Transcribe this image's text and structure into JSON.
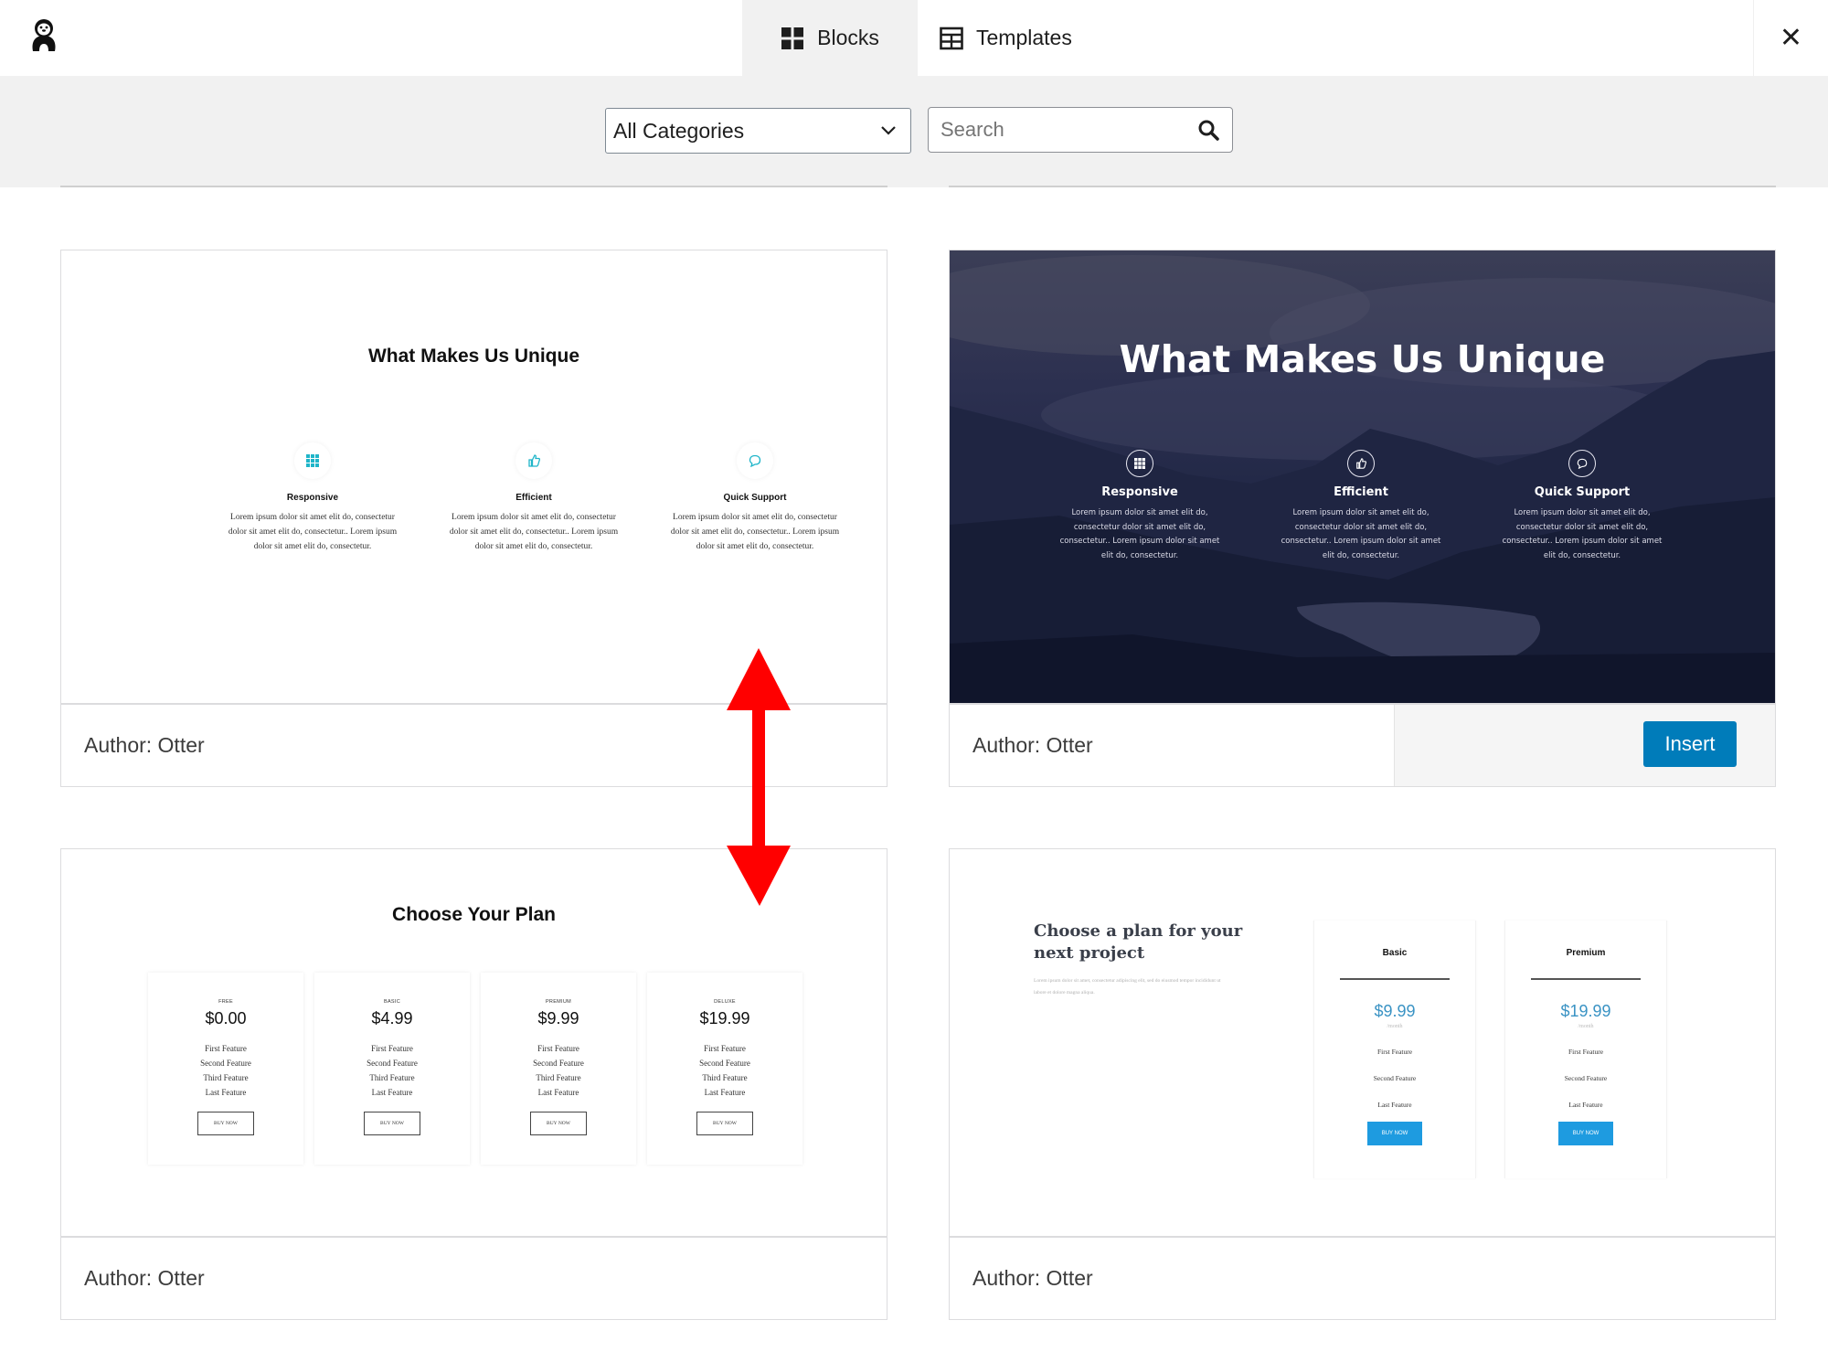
{
  "header": {
    "logo_icon": "otter-logo-icon",
    "tabs": [
      {
        "label": "Blocks",
        "icon": "blocks-grid-icon",
        "active": true
      },
      {
        "label": "Templates",
        "icon": "templates-table-icon",
        "active": false
      }
    ],
    "close_icon": "close-icon",
    "close_glyph": "✕"
  },
  "toolbar": {
    "category_select": {
      "value": "All Categories",
      "options_visible": [
        "All Categories"
      ]
    },
    "search": {
      "placeholder": "Search",
      "value": ""
    }
  },
  "cards": [
    {
      "author": "Author: Otter",
      "preview": {
        "title": "What Makes Us Unique",
        "features": [
          {
            "icon": "grid-icon",
            "name": "Responsive",
            "desc": "Lorem ipsum dolor sit amet elit do, consectetur dolor sit amet elit do, consectetur.. Lorem ipsum dolor sit amet elit do, consectetur."
          },
          {
            "icon": "thumbs-up-icon",
            "name": "Efficient",
            "desc": "Lorem ipsum dolor sit amet elit do, consectetur dolor sit amet elit do, consectetur.. Lorem ipsum dolor sit amet elit do, consectetur."
          },
          {
            "icon": "chat-bubble-icon",
            "name": "Quick Support",
            "desc": "Lorem ipsum dolor sit amet elit do, consectetur dolor sit amet elit do, consectetur.. Lorem ipsum dolor sit amet elit do, consectetur."
          }
        ],
        "accent_color": "#1fb5c9"
      }
    },
    {
      "author": "Author: Otter",
      "insert_label": "Insert",
      "preview": {
        "title": "What Makes Us Unique",
        "features": [
          {
            "icon": "grid-icon",
            "name": "Responsive",
            "desc": "Lorem ipsum dolor sit amet elit do, consectetur dolor sit amet elit do, consectetur.. Lorem ipsum dolor sit amet elit do, consectetur."
          },
          {
            "icon": "thumbs-up-icon",
            "name": "Efficient",
            "desc": "Lorem ipsum dolor sit amet elit do, consectetur dolor sit amet elit do, consectetur.. Lorem ipsum dolor sit amet elit do, consectetur."
          },
          {
            "icon": "chat-bubble-icon",
            "name": "Quick Support",
            "desc": "Lorem ipsum dolor sit amet elit do, consectetur dolor sit amet elit do, consectetur.. Lorem ipsum dolor sit amet elit do, consectetur."
          }
        ]
      }
    },
    {
      "author": "Author: Otter",
      "preview": {
        "title": "Choose Your Plan",
        "plans": [
          {
            "tier": "FREE",
            "price": "$0.00",
            "features": [
              "First Feature",
              "Second Feature",
              "Third Feature",
              "Last Feature"
            ],
            "button": "BUY NOW"
          },
          {
            "tier": "BASIC",
            "price": "$4.99",
            "features": [
              "First Feature",
              "Second Feature",
              "Third Feature",
              "Last Feature"
            ],
            "button": "BUY NOW"
          },
          {
            "tier": "PREMIUM",
            "price": "$9.99",
            "features": [
              "First Feature",
              "Second Feature",
              "Third Feature",
              "Last Feature"
            ],
            "button": "BUY NOW"
          },
          {
            "tier": "DELUXE",
            "price": "$19.99",
            "features": [
              "First Feature",
              "Second Feature",
              "Third Feature",
              "Last Feature"
            ],
            "button": "BUY NOW"
          }
        ]
      }
    },
    {
      "author": "Author: Otter",
      "preview": {
        "heading": "Choose a plan for your next project",
        "description": "Lorem ipsum dolor sit amet, consectetur adipiscing elit, sed do eiusmod tempor incididunt ut labore et dolore magna aliqua.",
        "plans": [
          {
            "name": "Basic",
            "price": "$9.99",
            "period": "/month",
            "features": [
              "First Feature",
              "Second Feature",
              "Last Feature"
            ],
            "button": "BUY NOW"
          },
          {
            "name": "Premium",
            "price": "$19.99",
            "period": "/month",
            "features": [
              "First Feature",
              "Second Feature",
              "Last Feature"
            ],
            "button": "BUY NOW"
          }
        ],
        "accent_color": "#1e9be0"
      }
    }
  ],
  "annotation": {
    "type": "double-headed-arrow",
    "color": "#ff0000",
    "meaning": "vertical spacing between rows"
  },
  "colors": {
    "primary_button": "#007cba",
    "toolbar_bg": "#f1f1f1"
  }
}
